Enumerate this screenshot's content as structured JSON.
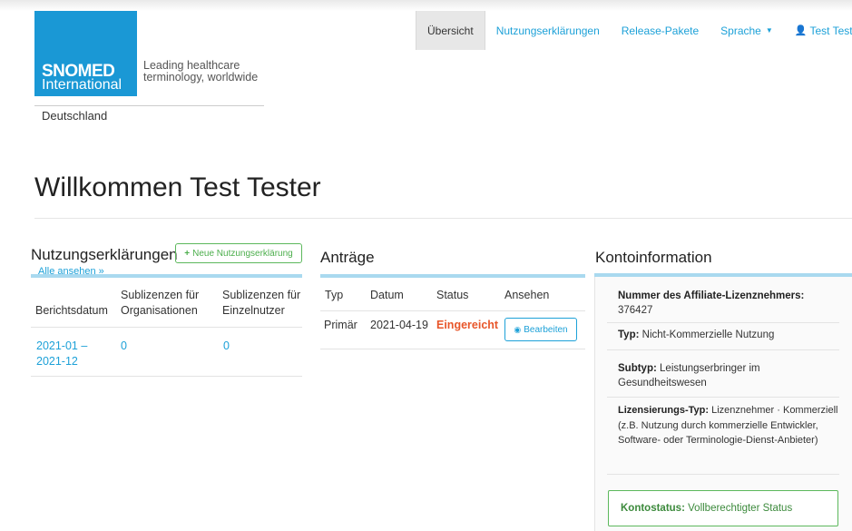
{
  "nav": {
    "items": [
      {
        "label": "Übersicht",
        "active": true
      },
      {
        "label": "Nutzungserklärungen"
      },
      {
        "label": "Release-Pakete"
      },
      {
        "label": "Sprache",
        "dropdown": true
      },
      {
        "label": "Test Tester",
        "dropdown": true,
        "icon": "user-icon"
      }
    ]
  },
  "logo": {
    "line1": "SNOMED",
    "line2": "International",
    "tagline1": "Leading healthcare",
    "tagline2": "terminology, worldwide",
    "brand_color": "#1a98d5"
  },
  "country": "Deutschland",
  "welcome": "Willkommen Test Tester",
  "declarations": {
    "title": "Nutzungserklärungen",
    "new_button": "Neue Nutzungserklärung",
    "see_all": "Alle ansehen »",
    "headers": [
      "Berichtsdatum",
      "Sublizenzen für Organisationen",
      "Sublizenzen für Einzelnutzer"
    ],
    "rows": [
      {
        "date_line1": "2021-01 –",
        "date_line2": "2021-12",
        "org": "0",
        "individual": "0"
      }
    ]
  },
  "applications": {
    "title": "Anträge",
    "headers": [
      "Typ",
      "Datum",
      "Status",
      "Ansehen"
    ],
    "rows": [
      {
        "type": "Primär",
        "date": "2021-04-19",
        "status": "Eingereicht",
        "action": "Bearbeiten"
      }
    ]
  },
  "account": {
    "title": "Kontoinformation",
    "affiliate_label": "Nummer des Affiliate-Lizenznehmers",
    "affiliate_number": "376427",
    "type_label": "Typ",
    "type_value": "Nicht-Kommerzielle Nutzung",
    "subtype_label": "Subtyp",
    "subtype_value": "Leistungserbringer im Gesundheitswesen",
    "license_type_label": "Lizensierungs-Typ",
    "license_type_value": "Lizenznehmer · Kommerziell (z.B. Nutzung durch kommerzielle Entwickler, Software- oder Terminologie-Dienst-Anbieter)",
    "status_label": "Kontostatus",
    "status_value": "Vollberechtigter Status"
  },
  "colors": {
    "link": "#1da1d8",
    "accent_bar": "#a9d9ef",
    "success": "#5cb85c",
    "submitted": "#e8562a"
  }
}
